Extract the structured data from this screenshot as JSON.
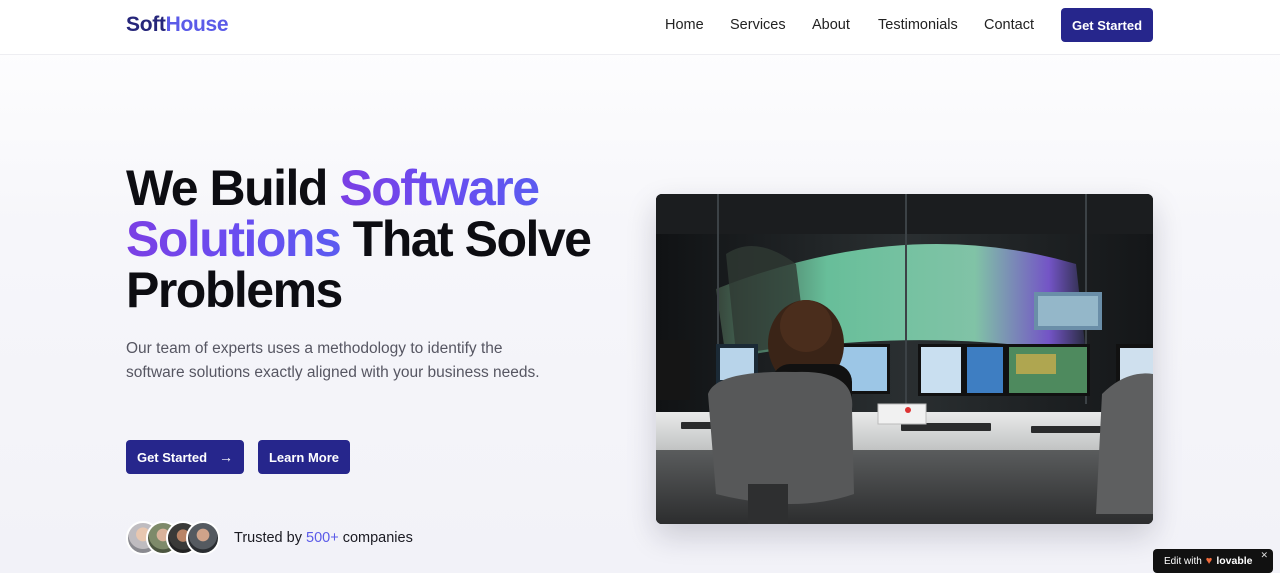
{
  "header": {
    "logo_part1": "Soft",
    "logo_part2": "House",
    "nav": [
      "Home",
      "Services",
      "About",
      "Testimonials",
      "Contact"
    ],
    "cta_label": "Get Started"
  },
  "hero": {
    "title_line1_plain": "We Build ",
    "title_line1_accent": "Software",
    "title_line2_accent": "Solutions",
    "title_line2_plain": " That Solve",
    "title_line3_plain": "Problems",
    "subtitle": "Our team of experts uses a methodology to identify the software solutions exactly aligned with your business needs.",
    "primary_button": "Get Started",
    "primary_button_icon": "arrow-right-icon",
    "secondary_button": "Learn More",
    "trust_prefix": "Trusted by ",
    "trust_count": "500+",
    "trust_suffix": " companies"
  },
  "badge": {
    "prefix": "Edit with",
    "brand": "lovable",
    "heart_icon": "heart-icon",
    "close_icon": "close-icon"
  },
  "colors": {
    "primary": "#26268c",
    "accent": "#5b5be8",
    "gradient_start": "#7b3fe4",
    "gradient_end": "#5b5bf0"
  }
}
